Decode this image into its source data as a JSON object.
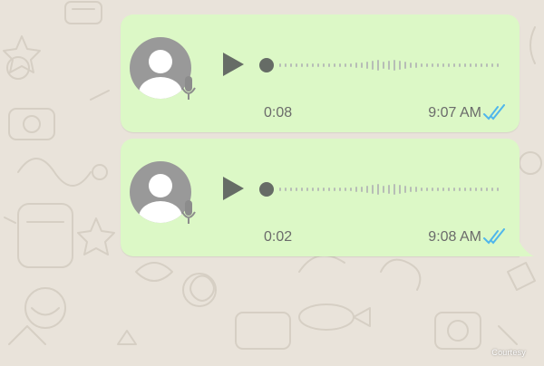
{
  "messages": [
    {
      "duration": "0:08",
      "time": "9:07 AM",
      "status_icon": "double-check-read-icon"
    },
    {
      "duration": "0:02",
      "time": "9:08 AM",
      "status_icon": "double-check-read-icon"
    }
  ],
  "watermark": "Courtesy",
  "colors": {
    "chat_background": "#e9e3da",
    "bubble": "#dcf8c6",
    "avatar": "#999999",
    "play": "#666c66",
    "read_ticks": "#4fb6ec",
    "meta_text": "#6b6b6b"
  }
}
